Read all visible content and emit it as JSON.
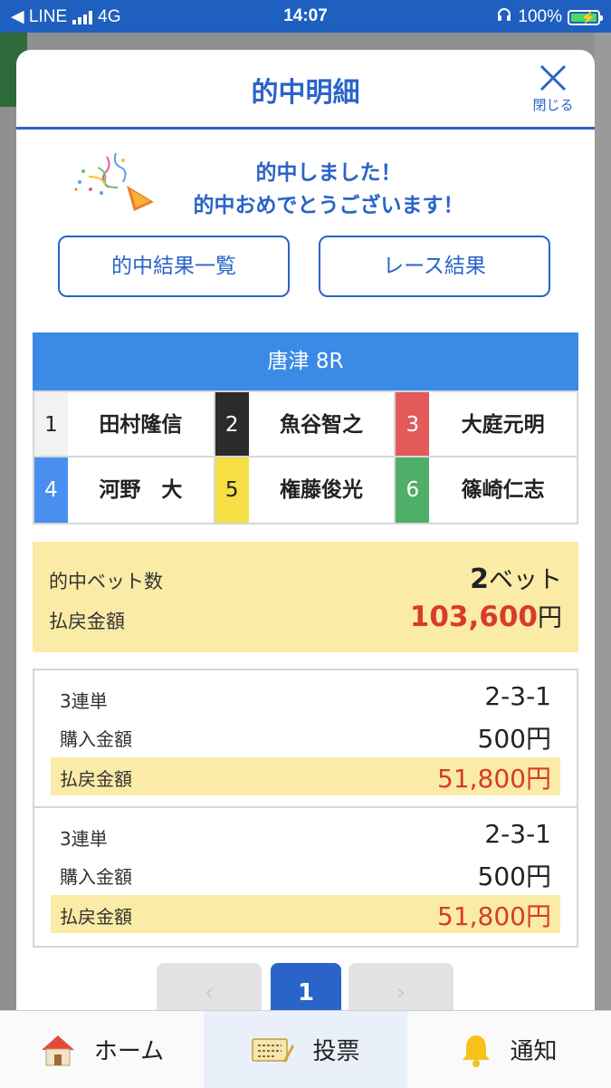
{
  "status_bar": {
    "back_app": "◀ LINE",
    "network": "4G",
    "time": "14:07",
    "battery": "100%"
  },
  "modal": {
    "title": "的中明細",
    "close_label": "閉じる",
    "congrats_line1": "的中しました！",
    "congrats_line2": "的中おめでとうございます！",
    "buttons": {
      "hit_list": "的中結果一覧",
      "race_result": "レース結果"
    },
    "race": {
      "name": "唐津 8R",
      "racers": [
        {
          "num": "1",
          "name": "田村隆信",
          "bg": "#f2f2f2",
          "fg": "#222222"
        },
        {
          "num": "2",
          "name": "魚谷智之",
          "bg": "#2b2b2b",
          "fg": "#ffffff"
        },
        {
          "num": "3",
          "name": "大庭元明",
          "bg": "#e25a5a",
          "fg": "#ffffff"
        },
        {
          "num": "4",
          "name": "河野　大",
          "bg": "#4a8ff0",
          "fg": "#ffffff"
        },
        {
          "num": "5",
          "name": "権藤俊光",
          "bg": "#f5df45",
          "fg": "#222222"
        },
        {
          "num": "6",
          "name": "篠崎仁志",
          "bg": "#4fae67",
          "fg": "#ffffff"
        }
      ]
    },
    "summary": {
      "bet_count_label": "的中ベット数",
      "bet_count_value": "2",
      "bet_count_unit": "ベット",
      "payout_label": "払戻金額",
      "payout_value": "103,600",
      "payout_unit": "円"
    },
    "bets": [
      {
        "type": "3連単",
        "combo": "2-3-1",
        "purchase_label": "購入金額",
        "purchase": "500円",
        "payout_label": "払戻金額",
        "payout": "51,800円"
      },
      {
        "type": "3連単",
        "combo": "2-3-1",
        "purchase_label": "購入金額",
        "purchase": "500円",
        "payout_label": "払戻金額",
        "payout": "51,800円"
      }
    ],
    "pager": {
      "prev": "‹",
      "current": "1",
      "next": "›"
    }
  },
  "tabbar": {
    "home": "ホーム",
    "vote": "投票",
    "notify": "通知"
  },
  "colors": {
    "brand_blue": "#2a64c8",
    "race_header": "#3a8ae6",
    "highlight_yellow": "#faeba6",
    "payout_red": "#d83b2b"
  }
}
